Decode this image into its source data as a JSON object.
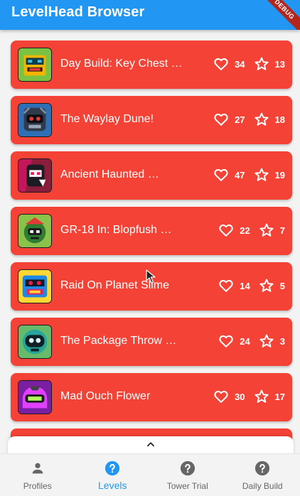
{
  "appbar": {
    "title": "LevelHead Browser",
    "debug_banner": "DEBUG",
    "color": "#2196f3"
  },
  "levels": [
    {
      "title": "Day Build: Key Chest …",
      "likes": "34",
      "stars": "13",
      "thumb_icon": "robot-thumbnail-green"
    },
    {
      "title": "The Waylay Dune!",
      "likes": "27",
      "stars": "18",
      "thumb_icon": "robot-thumbnail-blue"
    },
    {
      "title": "Ancient Haunted …",
      "likes": "47",
      "stars": "19",
      "thumb_icon": "robot-thumbnail-magenta"
    },
    {
      "title": "GR-18 In: Blopfush …",
      "likes": "22",
      "stars": "7",
      "thumb_icon": "robot-thumbnail-lime"
    },
    {
      "title": "Raid On Planet Slime",
      "likes": "14",
      "stars": "5",
      "thumb_icon": "robot-thumbnail-yellow"
    },
    {
      "title": "The Package Throw …",
      "likes": "24",
      "stars": "3",
      "thumb_icon": "robot-thumbnail-teal"
    },
    {
      "title": "Mad Ouch Flower",
      "likes": "30",
      "stars": "17",
      "thumb_icon": "robot-thumbnail-purple"
    }
  ],
  "card_color": "#f44336",
  "bottom_nav": {
    "items": [
      {
        "label": "Profiles",
        "icon": "person-icon",
        "active": false
      },
      {
        "label": "Levels",
        "icon": "help-circle-icon",
        "active": true
      },
      {
        "label": "Tower Trial",
        "icon": "help-circle-icon",
        "active": false
      },
      {
        "label": "Daily Build",
        "icon": "help-circle-icon",
        "active": false
      }
    ],
    "active_color": "#2196f3",
    "inactive_color": "#666666"
  }
}
